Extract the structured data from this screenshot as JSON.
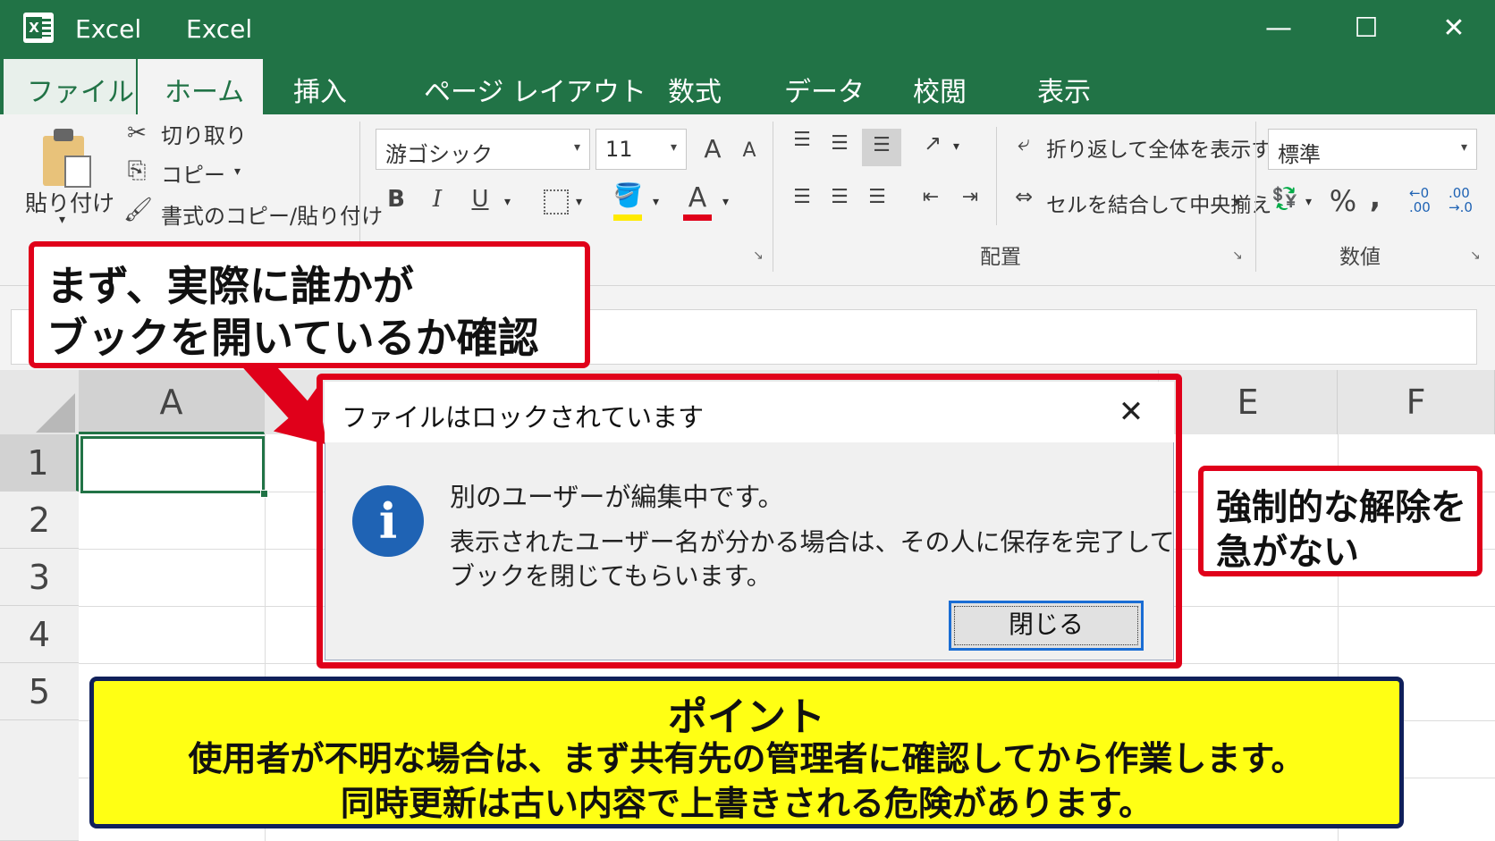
{
  "window": {
    "app_name": "Excel",
    "title": "Excel",
    "minimize": "—",
    "maximize": "☐",
    "close": "✕"
  },
  "tabs": [
    "ファイル",
    "ホーム",
    "挿入",
    "ページ レイアウト",
    "数式",
    "データ",
    "校閲",
    "表示"
  ],
  "ribbon": {
    "clipboard": {
      "paste_label": "貼り付け",
      "cut_label": "切り取り",
      "copy_label": "コピー",
      "format_painter_label": "書式のコピー/貼り付け"
    },
    "font": {
      "font_name": "游ゴシック",
      "font_size": "11",
      "grow_icon": "A",
      "shrink_icon": "A",
      "bold": "B",
      "italic": "I",
      "underline": "U",
      "font_color_icon": "A"
    },
    "alignment": {
      "wrap_label": "折り返して全体を表示する",
      "merge_label": "セルを結合して中央揃え",
      "group_label": "配置"
    },
    "number": {
      "format_value": "標準",
      "percent": "%",
      "comma": ",",
      "increase_decimal": "←0\n.00",
      "decrease_decimal": ".00\n→.0",
      "group_label": "数値"
    },
    "dropdown_arrow": "▾"
  },
  "grid": {
    "columns": [
      "A",
      "E",
      "F"
    ],
    "rows": [
      "1",
      "2",
      "3",
      "4",
      "5"
    ]
  },
  "dialog": {
    "title": "ファイルはロックされています",
    "close_icon": "✕",
    "info_icon": "i",
    "message_main": "別のユーザーが編集中です。",
    "message_sub_line1": "表示されたユーザー名が分かる場合は、その人に保存を完了して",
    "message_sub_line2": "ブックを閉じてもらいます。",
    "close_button": "閉じる"
  },
  "callouts": {
    "top_line1": "まず、実際に誰かが",
    "top_line2": "ブックを開いているか確認",
    "right_line1": "強制的な解除を",
    "right_line2": "急がない"
  },
  "point": {
    "heading": "ポイント",
    "line1": "使用者が不明な場合は、まず共有先の管理者に確認してから作業します。",
    "line2": "同時更新は古い内容で上書きされる危険があります。"
  },
  "colors": {
    "excel_green": "#217346",
    "callout_red": "#e0001a",
    "info_blue": "#1f63b4",
    "point_yellow": "#ffff14",
    "point_border": "#10205a"
  }
}
